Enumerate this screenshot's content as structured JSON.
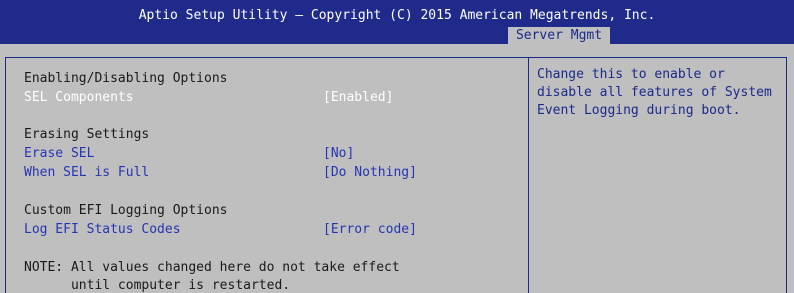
{
  "header": {
    "title": "Aptio Setup Utility – Copyright (C) 2015 American Megatrends, Inc.",
    "active_tab": "Server Mgmt"
  },
  "settings": {
    "section_enabling": "Enabling/Disabling Options",
    "sel_components_label": "SEL Components",
    "sel_components_value": "[Enabled]",
    "section_erasing": "Erasing Settings",
    "erase_sel_label": "Erase SEL",
    "erase_sel_value": "[No]",
    "when_full_label": "When SEL is Full",
    "when_full_value": "[Do Nothing]",
    "section_custom": "Custom EFI Logging Options",
    "log_efi_label": "Log EFI Status Codes",
    "log_efi_value": "[Error code]",
    "note_line1": "NOTE: All values changed here do not take effect",
    "note_line2": "      until computer is restarted."
  },
  "help": {
    "line1": "Change this to enable or",
    "line2": "disable all features of System",
    "line3": "Event Logging during boot."
  }
}
